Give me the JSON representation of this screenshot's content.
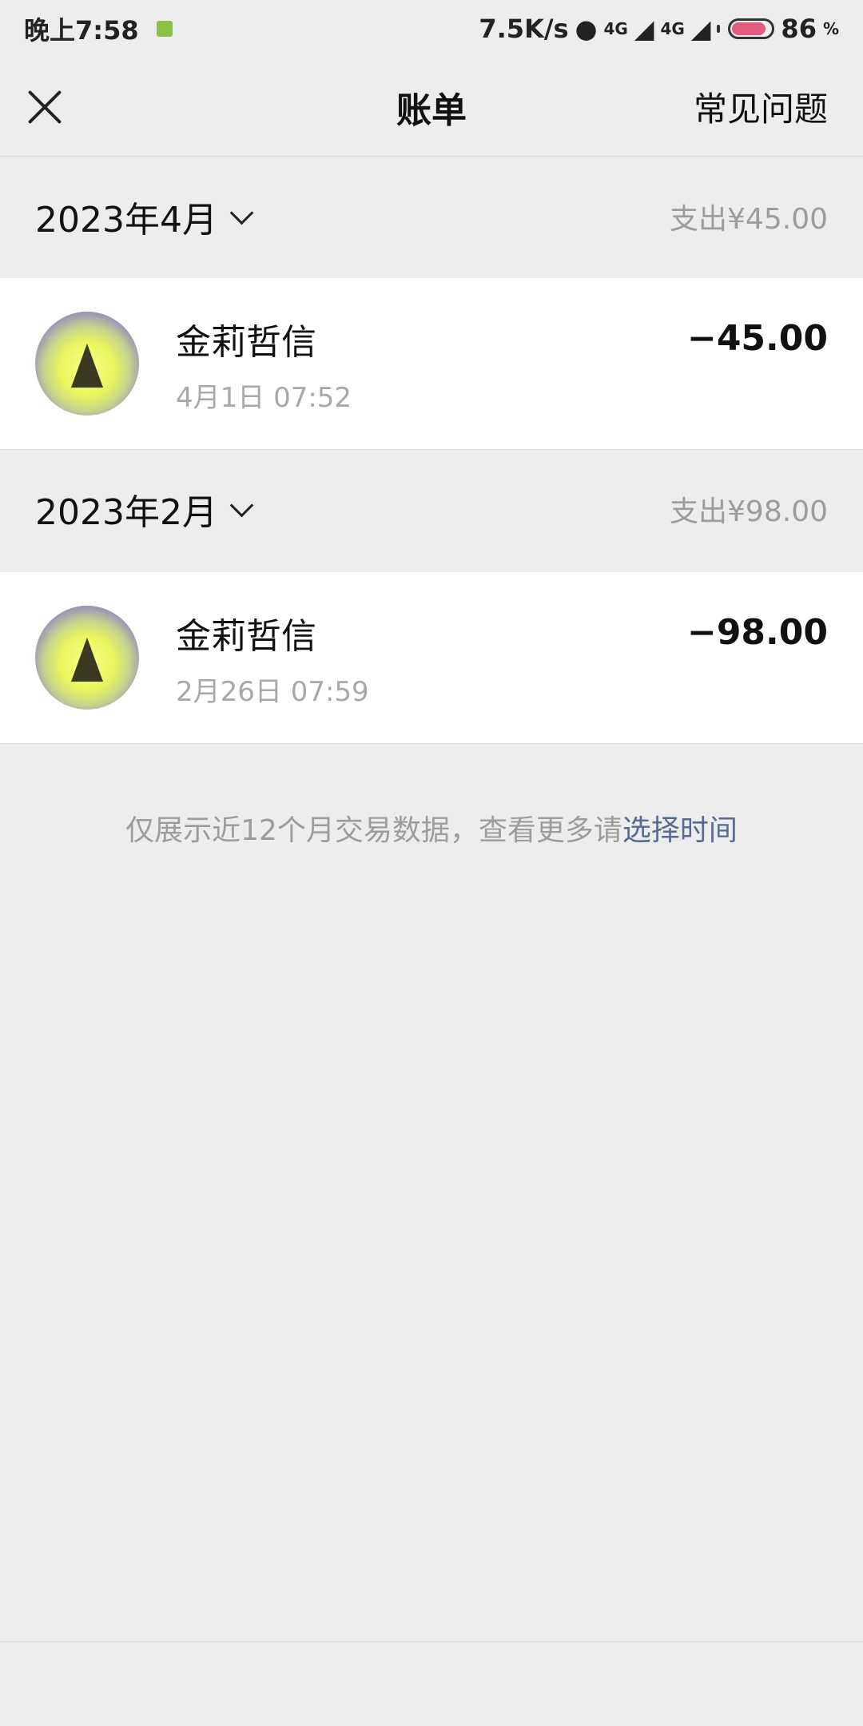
{
  "status_bar": {
    "time": "晚上7:58",
    "network_speed": "7.5K/s",
    "signal_label_1": "4G",
    "signal_label_2": "4G",
    "battery": "86",
    "battery_percent_sign": "%",
    "battery_level": 0.86,
    "app_icon": "app-notification-icon"
  },
  "nav": {
    "close_icon": "close-icon",
    "title": "账单",
    "faq": "常见问题"
  },
  "months": [
    {
      "label": "2023年4月",
      "total": "支出¥45.00",
      "transaction": {
        "name": "金莉哲信",
        "time": "4月1日 07:52",
        "amount": "−45.00"
      }
    },
    {
      "label": "2023年2月",
      "total": "支出¥98.00",
      "transaction": {
        "name": "金莉哲信",
        "time": "2月26日 07:59",
        "amount": "−98.00"
      }
    }
  ],
  "footer": {
    "note": "仅展示近12个月交易数据，查看更多请",
    "link": "选择时间"
  },
  "colors": {
    "background": "#ededed",
    "card": "#ffffff",
    "link": "#576b95",
    "muted": "#9c9c9c",
    "battery": "#e05b7e"
  }
}
